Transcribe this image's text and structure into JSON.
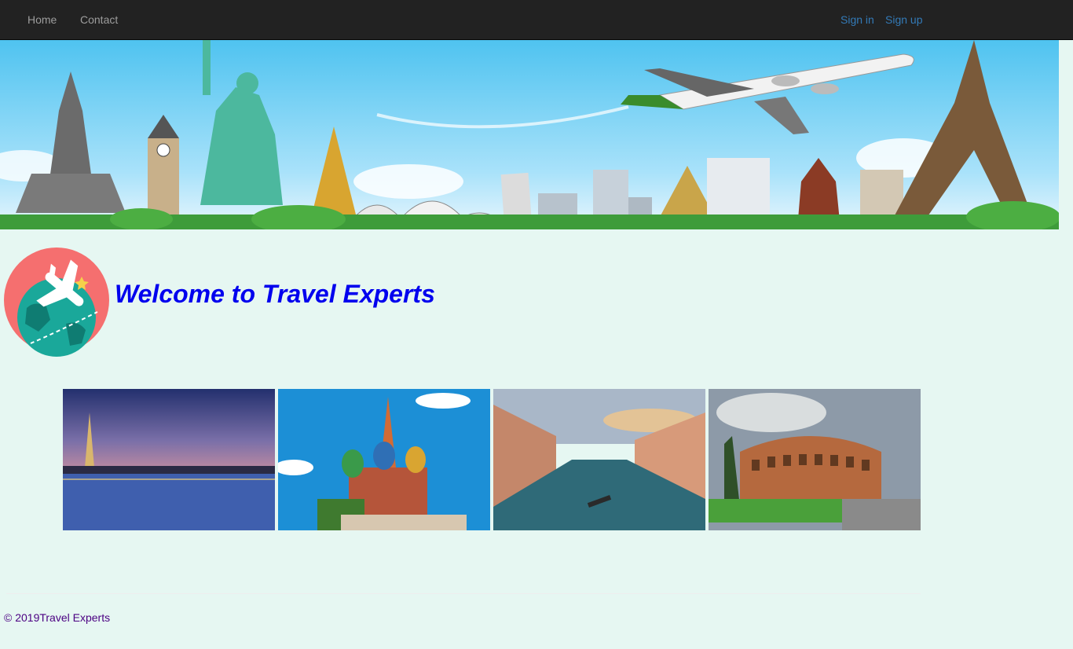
{
  "nav": {
    "left": [
      {
        "label": "Home"
      },
      {
        "label": "Contact"
      }
    ],
    "right": [
      {
        "label": "Sign in"
      },
      {
        "label": "Sign up"
      }
    ]
  },
  "banner": {
    "image": "world-landmarks-airplane-banner"
  },
  "hero": {
    "logo": "globe-airplane-logo",
    "title": "Welcome to Travel Experts"
  },
  "gallery": [
    {
      "image": "paris-eiffel-tower-night"
    },
    {
      "image": "moscow-saint-basils-cathedral"
    },
    {
      "image": "venice-grand-canal"
    },
    {
      "image": "rome-colosseum"
    }
  ],
  "footer": {
    "copyright": "© 2019Travel Experts"
  },
  "colors": {
    "navbar_bg": "#222222",
    "nav_link": "#9d9d9d",
    "nav_right_link": "#337ab7",
    "page_bg": "#e6f7f2",
    "title": "#0000ee",
    "footer_text": "#4b0082"
  }
}
